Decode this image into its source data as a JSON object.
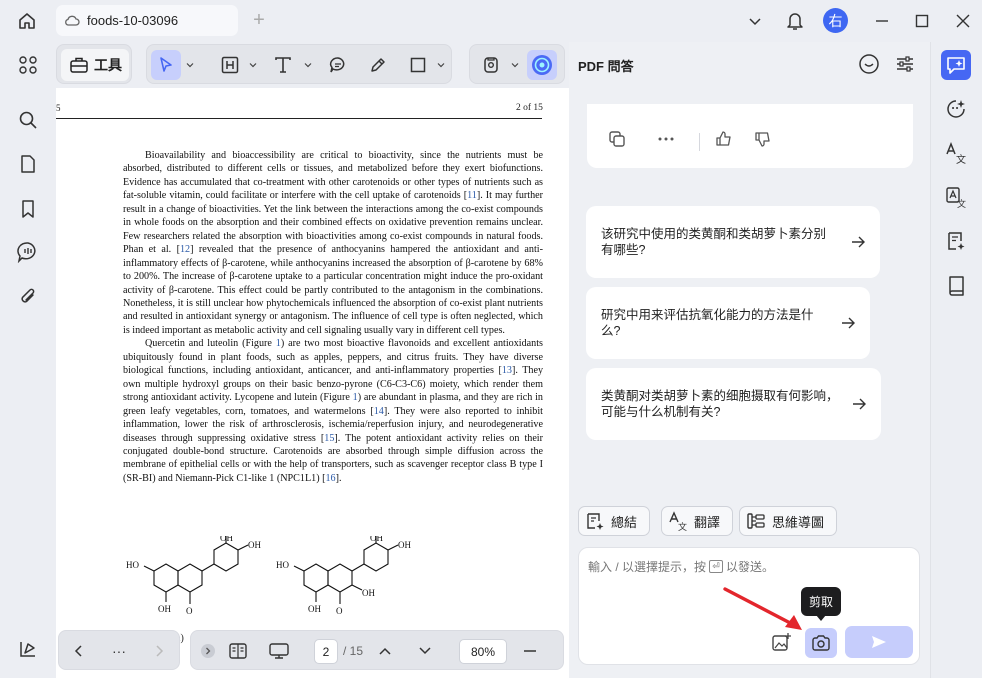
{
  "titlebar": {
    "tab_title": "foods-10-03096",
    "new_tab_symbol": "+",
    "avatar_text": "右"
  },
  "toolbar": {
    "tools_label": "工具"
  },
  "document": {
    "header_left": "5",
    "page_label": "2 of 15",
    "paragraph1": [
      {
        "t": "Bioavailability and bioaccessibility are critical to bioactivity, since the nutrients must be absorbed, distributed to different cells or tissues, and metabolized before they exert biofunctions. Evidence has accumulated that co-treatment with other carotenoids or other types of nutrients such as fat-soluble vitamin, could facilitate or interfere with the cell uptake of carotenoids ["
      },
      {
        "c": "11"
      },
      {
        "t": "]. It may further result in a change of bioactivities. Yet the link between the interactions among the co-exist compounds in whole foods on the absorption and their combined effects on oxidative prevention remains unclear. Few researchers related the absorption with bioactivities among co-exist compounds in natural foods. Phan et al. ["
      },
      {
        "c": "12"
      },
      {
        "t": "] revealed that the presence of anthocyanins hampered the antioxidant and anti-inflammatory effects of β-carotene, while anthocyanins increased the absorption of β-carotene by 68% to 200%. The increase of β-carotene uptake to a particular concentration might induce the pro-oxidant activity of β-carotene. This effect could be partly contributed to the antagonism in the combinations. Nonetheless, it is still unclear how phytochemicals influenced the absorption of co-exist plant nutrients and resulted in antioxidant synergy or antagonism. The influence of cell type is often neglected, which is indeed important as metabolic activity and cell signaling usually vary in different cell types."
      }
    ],
    "paragraph2": [
      {
        "t": "Quercetin and luteolin (Figure "
      },
      {
        "c": "1"
      },
      {
        "t": ") are two most bioactive flavonoids and excellent antioxidants ubiquitously found in plant foods, such as apples, peppers, and citrus fruits. They have diverse biological functions, including antioxidant, anticancer, and anti-inflammatory properties ["
      },
      {
        "c": "13"
      },
      {
        "t": "]. They own multiple hydroxyl groups on their basic benzo-pyrone (C6-C3-C6) moiety, which render them strong antioxidant activity. Lycopene and lutein (Figure "
      },
      {
        "c": "1"
      },
      {
        "t": ") are abundant in plasma, and they are rich in green leafy vegetables, corn, tomatoes, and watermelons ["
      },
      {
        "c": "14"
      },
      {
        "t": "]. They were also reported to inhibit inflammation, lower the risk of arthrosclerosis, ischemia/reperfusion injury, and neurodegenerative diseases through suppressing oxidative stress ["
      },
      {
        "c": "15"
      },
      {
        "t": "]. The potent antioxidant activity relies on their conjugated double-bond structure. Carotenoids are absorbed through simple diffusion across the membrane of epithelial cells or with the help of transporters, such as scavenger receptor class B type I (SR-BI) and Niemann-Pick C1-like 1 (NPC1L1) ["
      },
      {
        "c": "16"
      },
      {
        "t": "]."
      }
    ],
    "fig_caption_fragment": "a)"
  },
  "bottom_nav": {
    "more": "···",
    "page_current": "2",
    "page_total": "/ 15",
    "zoom": "80%"
  },
  "ai_panel": {
    "title": "PDF 問答",
    "suggestions": [
      "该研究中使用的类黄酮和类胡萝卜素分别有哪些?",
      "研究中用来评估抗氧化能力的方法是什么?",
      "类黄酮对类胡萝卜素的细胞摄取有何影响，可能与什么机制有关?"
    ],
    "chips": [
      "總結",
      "翻譯",
      "思維導圖"
    ],
    "input_placeholder_pre": "輸入 / 以選擇提示，按",
    "input_placeholder_post": "以發送。",
    "tooltip": "剪取"
  },
  "colors": {
    "accent": "#4667f3",
    "accent_light": "#c6cdfc",
    "annotation_arrow": "#e3262c",
    "citation": "#2b5aa8"
  },
  "icons": {
    "left_rail": [
      "grid-icon",
      "search-icon",
      "page-icon",
      "bookmark-icon",
      "comment-icon",
      "paperclip-icon",
      "layers-icon"
    ],
    "right_rail": [
      "ai-chat-icon",
      "ai-sparkle-icon",
      "translate-icon",
      "translate-doc-icon",
      "summary-icon",
      "book-icon"
    ]
  }
}
